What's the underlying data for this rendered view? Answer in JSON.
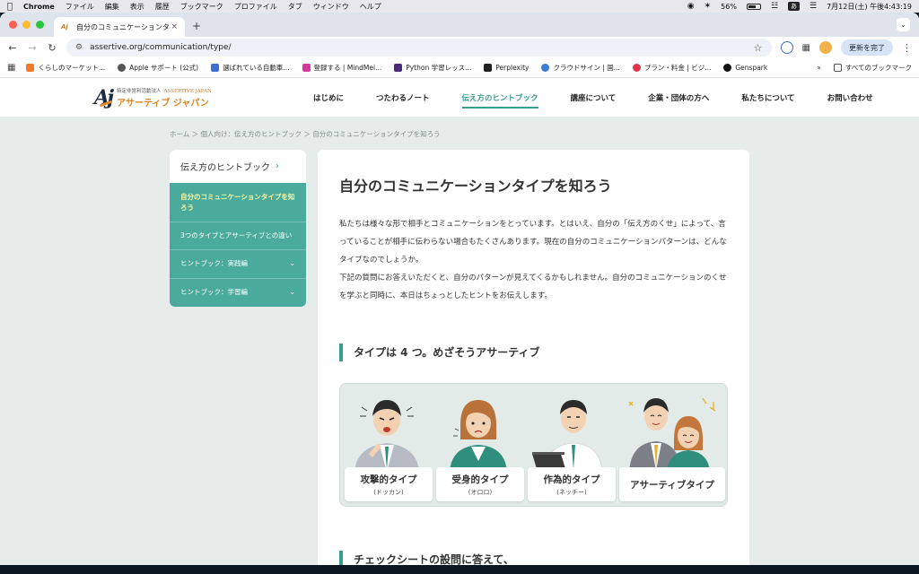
{
  "menubar": {
    "app": "Chrome",
    "menus": [
      "ファイル",
      "編集",
      "表示",
      "履歴",
      "ブックマーク",
      "プロファイル",
      "タブ",
      "ウィンドウ",
      "ヘルプ"
    ],
    "battery": "56%",
    "ime": "あ",
    "datetime": "7月12日(土) 午後4:43:19"
  },
  "browser": {
    "tab_title": "自分のコミュニケーションタイプ",
    "tab_close": "×",
    "new_tab": "+",
    "url": "assertive.org/communication/type/",
    "update_button": "更新を完了",
    "bookmarks": [
      {
        "label": "くらしのマーケット...",
        "color": "#f07a2a"
      },
      {
        "label": "Apple サポート (公式)",
        "color": "#555555"
      },
      {
        "label": "選ばれている自動車...",
        "color": "#3b6fd6"
      },
      {
        "label": "登録する | MindMei...",
        "color": "#d63b9c"
      },
      {
        "label": "Python 学習レッス...",
        "color": "#4a2a7a"
      },
      {
        "label": "Perplexity",
        "color": "#222222"
      },
      {
        "label": "クラウドサイン | 国...",
        "color": "#3a7bd5"
      },
      {
        "label": "プラン・料金 | ビジ...",
        "color": "#e0344a"
      },
      {
        "label": "Genspark",
        "color": "#111111"
      }
    ],
    "bookmarks_more": "»",
    "all_bookmarks": "すべてのブックマーク"
  },
  "site": {
    "logo_mark": "Aj",
    "logo_sub": "特定非営利活動法人",
    "logo_sub_en": "ASSERTIVE JAPAN",
    "logo_name": "アサーティブ ジャパン",
    "nav": [
      {
        "label": "はじめに",
        "active": false
      },
      {
        "label": "つたわるノート",
        "active": false
      },
      {
        "label": "伝え方のヒントブック",
        "active": true
      },
      {
        "label": "講座について",
        "active": false
      },
      {
        "label": "企業・団体の方へ",
        "active": false
      },
      {
        "label": "私たちについて",
        "active": false
      },
      {
        "label": "お問い合わせ",
        "active": false
      }
    ],
    "breadcrumb": "ホーム ＞ 個人向け：伝え方のヒントブック ＞ 自分のコミュニケーションタイプを知ろう",
    "sidenav": {
      "heading": "伝え方のヒントブック",
      "items": [
        {
          "label": "自分のコミュニケーションタイプを知ろう",
          "current": true,
          "expandable": false
        },
        {
          "label": "3つのタイプとアサーティブとの違い",
          "current": false,
          "expandable": false
        },
        {
          "label": "ヒントブック：実践編",
          "current": false,
          "expandable": true
        },
        {
          "label": "ヒントブック：学習編",
          "current": false,
          "expandable": true
        }
      ]
    },
    "article": {
      "title": "自分のコミュニケーションタイプを知ろう",
      "intro_1": "私たちは様々な形で相手とコミュニケーションをとっています。とはいえ、自分の「伝え方のくせ」によって、言っていることが相手に伝わらない場合もたくさんあります。現在の自分のコミュニケーションパターンは、どんなタイプなのでしょうか。",
      "intro_2": "下記の質問にお答えいただくと、自分のパターンが見えてくるかもしれません。自分のコミュニケーションのくせを学ぶと同時に、本日はちょっとしたヒントをお伝えします。",
      "section_title": "タイプは 4 つ。めざそうアサーティブ",
      "types": [
        {
          "name": "攻撃的タイプ",
          "kana": "(ドッカン)"
        },
        {
          "name": "受身的タイプ",
          "kana": "(オロロ)"
        },
        {
          "name": "作為的タイプ",
          "kana": "(ネッチー)"
        },
        {
          "name": "アサーティブタイプ",
          "kana": ""
        }
      ],
      "next_section_title": "チェックシートの設問に答えて、"
    }
  },
  "colors": {
    "accent": "#3b9b8c",
    "sidenav_bg": "#4aab9c",
    "brand_orange": "#d88527",
    "page_bg": "#e5ecea"
  }
}
